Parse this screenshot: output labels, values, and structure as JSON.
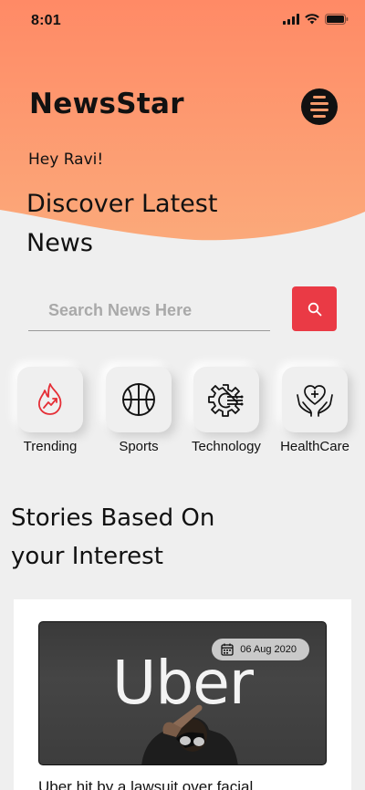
{
  "status_bar": {
    "time": "8:01"
  },
  "app": {
    "title": "NewsStar",
    "greeting": "Hey Ravi!",
    "headline": "Discover Latest News"
  },
  "colors": {
    "hero_top": "#ff8c66",
    "hero_bottom": "#fba579",
    "search_button": "#ea3a45",
    "background": "#efefef",
    "trending_icon": "#e52e36"
  },
  "search": {
    "placeholder": "Search News Here",
    "button_icon": "search-icon"
  },
  "categories": [
    {
      "label": "Trending",
      "icon": "flame-trend-icon"
    },
    {
      "label": "Sports",
      "icon": "basketball-icon"
    },
    {
      "label": "Technology",
      "icon": "gear-circuit-icon"
    },
    {
      "label": "HealthCare",
      "icon": "heart-hands-icon"
    }
  ],
  "section": {
    "title": "Stories Based On your Interest"
  },
  "story": {
    "image_text": "Uber",
    "date": "06 Aug 2020",
    "title": "Uber hit by a lawsuit over facial"
  }
}
